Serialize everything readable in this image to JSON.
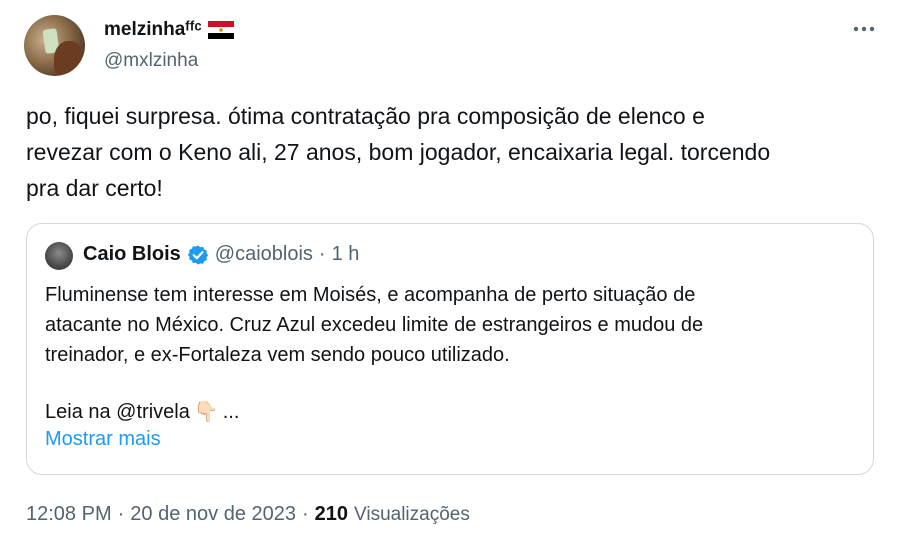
{
  "author": {
    "name": "melzinhaᶠᶠᶜ",
    "handle": "@mxlzinha",
    "flag_icon": "egypt-flag-icon"
  },
  "more_icon": "more-horizontal-icon",
  "tweet": {
    "line1": "po, fiquei surpresa. ótima contratação pra composição de elenco e",
    "line2": "revezar com o Keno ali, 27 anos, bom jogador, encaixaria legal. torcendo",
    "line3": "pra dar certo!"
  },
  "quote": {
    "name": "Caio Blois",
    "verified_icon": "verified-badge-icon",
    "handle": "@caioblois",
    "separator": "·",
    "time": "1 h",
    "text_line1": "Fluminense tem interesse em Moisés, e acompanha de perto situação de",
    "text_line2": "atacante no México. Cruz Azul excedeu limite de estrangeiros e mudou de",
    "text_line3": "treinador, e ex-Fortaleza vem sendo pouco utilizado.",
    "read_prefix": "Leia na @trivela",
    "pointing_emoji": "👇🏻",
    "ellipsis": "...",
    "show_more": "Mostrar mais"
  },
  "meta": {
    "time": "12:08 PM",
    "sep1": "·",
    "date": "20 de nov de 2023",
    "sep2": "·",
    "views_count": "210",
    "views_label": "Visualizações"
  },
  "colors": {
    "text": "#0f1419",
    "secondary": "#536471",
    "link": "#1d9bf0",
    "border": "#cfd9de"
  }
}
